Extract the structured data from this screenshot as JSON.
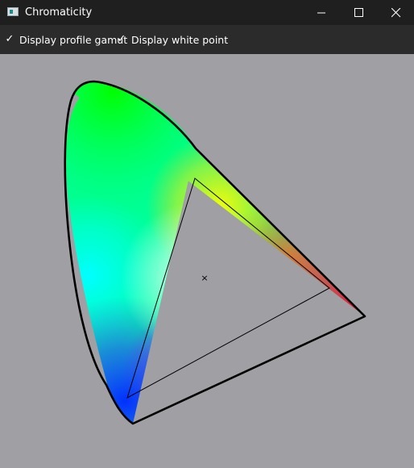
{
  "window": {
    "title": "Chromaticity",
    "icon": "app-icon",
    "controls": [
      "minimize-icon",
      "maximize-icon",
      "close-icon"
    ]
  },
  "toolbar": {
    "display_profile_gamut": {
      "label": "Display profile gamut",
      "checked": true,
      "mark": "✓"
    },
    "display_white_point": {
      "label": "Display white point",
      "checked": true,
      "mark": "✓"
    }
  },
  "diagram": {
    "background": "#a09fa4",
    "gamut_triangle": {
      "red": [
        0.64,
        0.33
      ],
      "green": [
        0.3,
        0.6
      ],
      "blue": [
        0.15,
        0.06
      ]
    },
    "white_point": [
      0.3127,
      0.329
    ],
    "white_point_marker": "×"
  }
}
